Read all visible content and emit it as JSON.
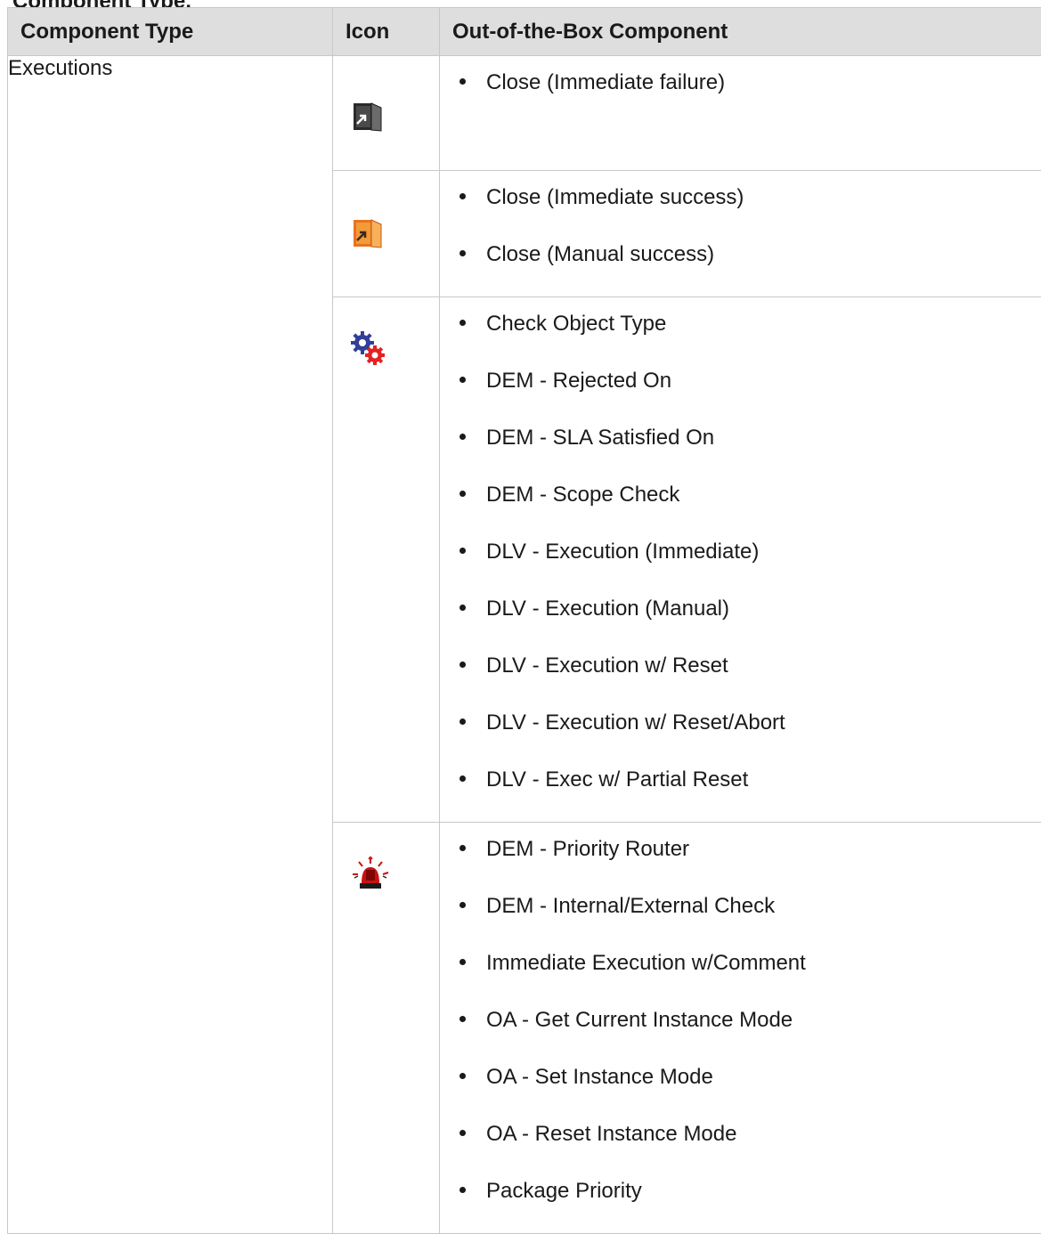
{
  "heading_fragment": "Component Type, ",
  "table": {
    "headers": [
      "Component Type",
      "Icon",
      "Out-of-the-Box Component"
    ],
    "component_type": "Executions",
    "groups": [
      {
        "icon": "door-close-gray-icon",
        "items": [
          "Close (Immediate failure)"
        ]
      },
      {
        "icon": "door-close-orange-icon",
        "items": [
          "Close (Immediate success)",
          "Close (Manual success)"
        ]
      },
      {
        "icon": "gears-icon",
        "items": [
          "Check Object Type",
          "DEM - Rejected On",
          "DEM - SLA Satisfied On",
          "DEM - Scope Check",
          "DLV - Execution (Immediate)",
          "DLV - Execution (Manual)",
          "DLV - Execution w/ Reset",
          "DLV - Execution w/ Reset/Abort",
          "DLV - Exec w/ Partial Reset"
        ]
      },
      {
        "icon": "siren-alarm-icon",
        "items": [
          "DEM - Priority Router",
          "DEM - Internal/External Check",
          "Immediate Execution w/Comment",
          "OA - Get Current Instance Mode",
          "OA - Set Instance Mode",
          "OA - Reset Instance Mode",
          "Package Priority"
        ]
      }
    ]
  }
}
